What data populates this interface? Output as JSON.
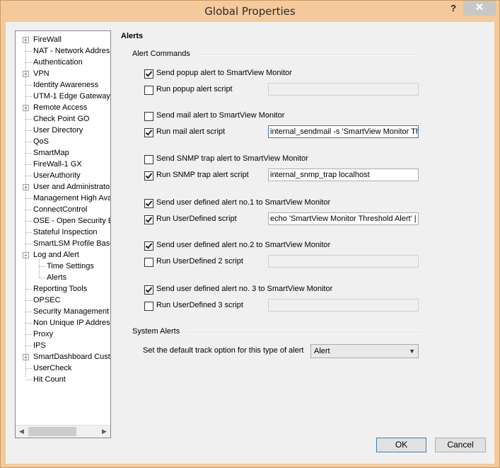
{
  "window": {
    "title": "Global Properties",
    "help_glyph": "?",
    "close_glyph": "✕"
  },
  "tree": {
    "items": [
      {
        "label": "FireWall",
        "expander": "+"
      },
      {
        "label": "NAT - Network Addres"
      },
      {
        "label": "Authentication"
      },
      {
        "label": "VPN",
        "expander": "+"
      },
      {
        "label": "Identity Awareness"
      },
      {
        "label": "UTM-1 Edge Gateway"
      },
      {
        "label": "Remote Access",
        "expander": "+"
      },
      {
        "label": "Check Point GO"
      },
      {
        "label": "User Directory"
      },
      {
        "label": "QoS"
      },
      {
        "label": "SmartMap"
      },
      {
        "label": "FireWall-1 GX"
      },
      {
        "label": "UserAuthority"
      },
      {
        "label": "User and Administrator",
        "expander": "+"
      },
      {
        "label": "Management High Ava"
      },
      {
        "label": "ConnectControl"
      },
      {
        "label": "OSE - Open Security E"
      },
      {
        "label": "Stateful Inspection"
      },
      {
        "label": "SmartLSM Profile Base"
      },
      {
        "label": "Log and Alert",
        "expander": "−"
      },
      {
        "label": "Time Settings",
        "child": true
      },
      {
        "label": "Alerts",
        "child": true,
        "selected": true
      },
      {
        "label": "Reporting Tools"
      },
      {
        "label": "OPSEC"
      },
      {
        "label": "Security Management ."
      },
      {
        "label": "Non Unique IP Address"
      },
      {
        "label": "Proxy"
      },
      {
        "label": "IPS"
      },
      {
        "label": "SmartDashboard Custo",
        "expander": "+"
      },
      {
        "label": "UserCheck"
      },
      {
        "label": "Hit Count"
      }
    ],
    "scroll_left": "◀",
    "scroll_right": "▶"
  },
  "panel": {
    "title": "Alerts",
    "alert_commands_label": "Alert Commands",
    "system_alerts_label": "System Alerts",
    "rows": [
      {
        "checkbox_label": "Send popup alert to SmartView Monitor",
        "checked": true
      },
      {
        "checkbox_label": "Run popup alert script",
        "checked": false,
        "field": ""
      },
      {
        "checkbox_label": "Send mail alert to SmartView Monitor",
        "checked": false
      },
      {
        "checkbox_label": "Run mail alert script",
        "checked": true,
        "field": "internal_sendmail -s 'SmartView Monitor Thre"
      },
      {
        "checkbox_label": "Send SNMP trap alert to SmartView Monitor",
        "checked": false
      },
      {
        "checkbox_label": "Run SNMP trap alert script",
        "checked": true,
        "field": "internal_snmp_trap localhost"
      },
      {
        "checkbox_label": "Send user defined alert no.1 to SmartView Monitor",
        "checked": true
      },
      {
        "checkbox_label": "Run UserDefined script",
        "checked": true,
        "field": "echo 'SmartView Monitor Threshold Alert' | $"
      },
      {
        "checkbox_label": "Send user defined alert no.2 to SmartView Monitor",
        "checked": true
      },
      {
        "checkbox_label": "Run UserDefined 2 script",
        "checked": false,
        "field": ""
      },
      {
        "checkbox_label": "Send user defined alert no. 3 to SmartView Monitor",
        "checked": true
      },
      {
        "checkbox_label": "Run UserDefined 3 script",
        "checked": false,
        "field": ""
      }
    ],
    "default_track_label": "Set the default track option for this type of alert",
    "default_track_value": "Alert"
  },
  "buttons": {
    "ok": "OK",
    "cancel": "Cancel"
  }
}
